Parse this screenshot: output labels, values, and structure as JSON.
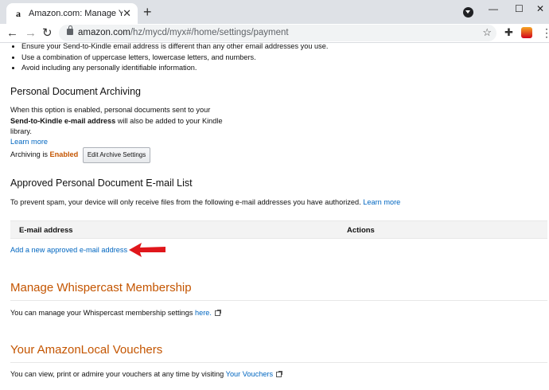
{
  "browser": {
    "tab_title": "Amazon.com: Manage Your Cont",
    "tab_favicon": "a",
    "url_host": "amazon.com",
    "url_path": "/hz/mycd/myx#/home/settings/payment"
  },
  "page": {
    "bullets": [
      "Ensure your Send-to-Kindle email address is different than any other email addresses you use.",
      "Use a combination of uppercase letters, lowercase letters, and numbers.",
      "Avoid including any personally identifiable information."
    ],
    "archiving": {
      "heading": "Personal Document Archiving",
      "desc_1": "When this option is enabled, personal documents sent to your",
      "desc_bold": "Send-to-Kindle e-mail address",
      "desc_2": " will also be added to your Kindle",
      "desc_3": "library.",
      "learn_more": "Learn more",
      "status_prefix": "Archiving is ",
      "status_value": "Enabled",
      "edit_button": "Edit Archive Settings"
    },
    "approved": {
      "heading": "Approved Personal Document E-mail List",
      "desc": "To prevent spam, your device will only receive files from the following e-mail addresses you have authorized. ",
      "learn_more": "Learn more",
      "col_email": "E-mail address",
      "col_actions": "Actions",
      "add_link": "Add a new approved e-mail address"
    },
    "whispercast": {
      "heading": "Manage Whispercast Membership",
      "desc": "You can manage your Whispercast membership settings ",
      "link": "here."
    },
    "vouchers": {
      "heading": "Your AmazonLocal Vouchers",
      "desc": "You can view, print or admire your vouchers at any time by visiting ",
      "link": "Your Vouchers"
    }
  },
  "colors": {
    "accent_orange": "#c45500",
    "link_blue": "#0066c0",
    "arrow_red": "#e0161b"
  }
}
